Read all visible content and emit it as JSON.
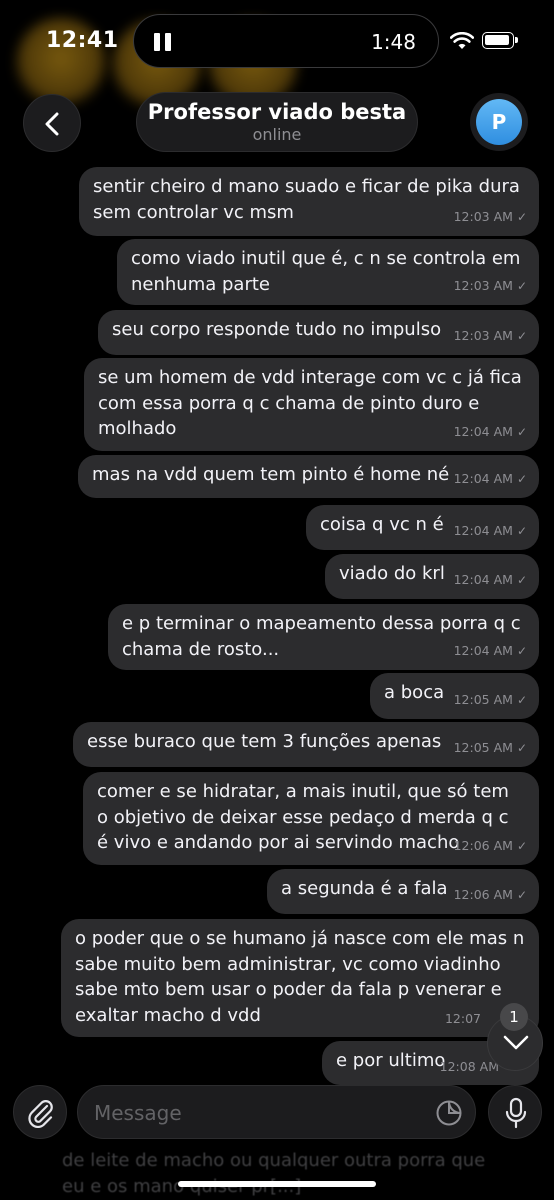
{
  "status_bar": {
    "time": "12:41",
    "playback_time": "1:48"
  },
  "header": {
    "title": "Professor viado besta",
    "status": "online",
    "avatar_letter": "P"
  },
  "messages": [
    {
      "text": "sentir cheiro d mano suado e ficar de pika dura sem controlar vc msm",
      "time": "12:03 AM"
    },
    {
      "text": "como viado inutil que é, c n se controla em nenhuma parte",
      "time": "12:03 AM"
    },
    {
      "text": "seu corpo responde tudo no impulso",
      "time": "12:03 AM"
    },
    {
      "text": "se um homem de vdd interage com vc c já fica com essa porra q c chama de pinto duro e molhado",
      "time": "12:04 AM"
    },
    {
      "text": "mas na vdd quem tem pinto é home né",
      "time": "12:04 AM"
    },
    {
      "text": "coisa q vc n é",
      "time": "12:04 AM"
    },
    {
      "text": "viado do krl",
      "time": "12:04 AM"
    },
    {
      "text": "e p terminar o mapeamento dessa porra q c chama de rosto...",
      "time": "12:04 AM"
    },
    {
      "text": "a boca",
      "time": "12:05 AM"
    },
    {
      "text": "esse buraco que tem 3 funções apenas",
      "time": "12:05 AM"
    },
    {
      "text": "comer e se hidratar, a mais inutil, que só tem o objetivo de deixar esse pedaço d merda q c é vivo e andando por ai servindo macho",
      "time": "12:06 AM"
    },
    {
      "text": "a segunda é a fala",
      "time": "12:06 AM"
    },
    {
      "text": "o poder que o se humano já nasce com ele mas n sabe muito bem administrar, vc como viadinho sabe mto bem usar o poder da fala p venerar e exaltar macho d vdd",
      "time": "12:07"
    },
    {
      "text": "e por ultimo",
      "time": "12:08 AM"
    }
  ],
  "scroll": {
    "unread_count": "1"
  },
  "input": {
    "placeholder": "Message"
  },
  "ghost_text": "de leite de macho ou qualquer outra porra que eu e os mano quiser pr[...]"
}
